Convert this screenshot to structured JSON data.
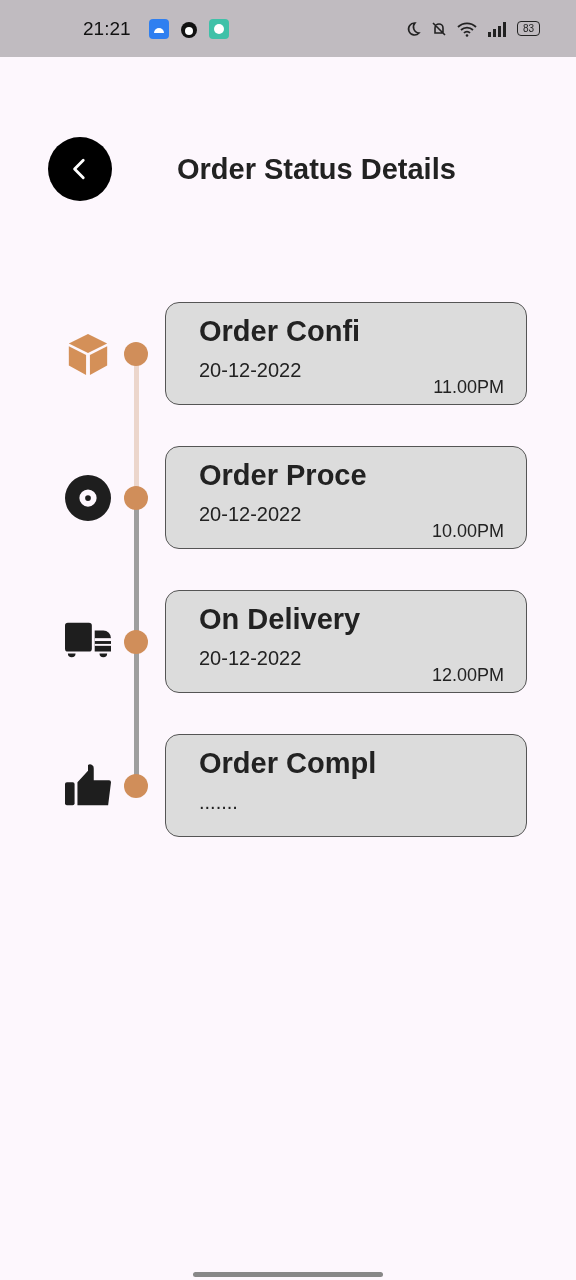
{
  "status_bar": {
    "time": "21:21",
    "battery": "83"
  },
  "header": {
    "title": "Order Status Details"
  },
  "steps": [
    {
      "kind": "box",
      "title": "Order Confi",
      "date": "20-12-2022",
      "time": "11.00PM",
      "active": true
    },
    {
      "kind": "disc",
      "title": "Order Proce",
      "date": "20-12-2022",
      "time": "10.00PM",
      "active": false
    },
    {
      "kind": "truck",
      "title": "On Delivery",
      "date": "20-12-2022",
      "time": "12.00PM",
      "active": false
    },
    {
      "kind": "thumb",
      "title": "Order Compl",
      "date": ".......",
      "active": false
    }
  ]
}
